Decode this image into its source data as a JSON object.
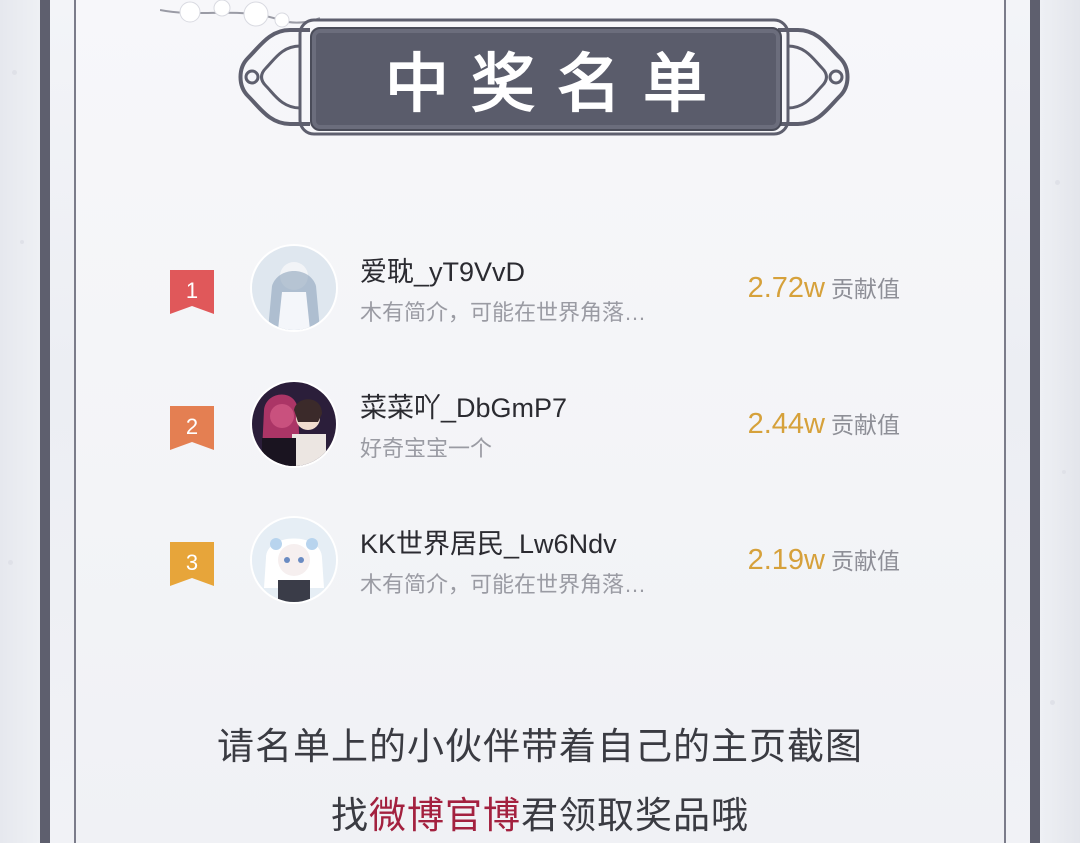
{
  "banner": {
    "title": "中奖名单"
  },
  "winners": [
    {
      "rank": "1",
      "name": "爱耽_yT9VvD",
      "bio": "木有简介，可能在世界角落…",
      "score": "2.72w",
      "score_label": "贡献值"
    },
    {
      "rank": "2",
      "name": "菜菜吖_DbGmP7",
      "bio": "好奇宝宝一个",
      "score": "2.44w",
      "score_label": "贡献值"
    },
    {
      "rank": "3",
      "name": "KK世界居民_Lw6Ndv",
      "bio": "木有简介，可能在世界角落…",
      "score": "2.19w",
      "score_label": "贡献值"
    }
  ],
  "footer": {
    "line1": "请名单上的小伙伴带着自己的主页截图",
    "line2_prefix": "找",
    "line2_highlight": "微博官博",
    "line2_suffix": "君领取奖品哦"
  },
  "colors": {
    "frame": "#5e5f6e",
    "title_plate": "#5a5c6b",
    "score": "#d6a13b",
    "highlight": "#a3213f",
    "rank_1": "#e0585a",
    "rank_2": "#e47f52",
    "rank_3": "#e7a53a"
  }
}
